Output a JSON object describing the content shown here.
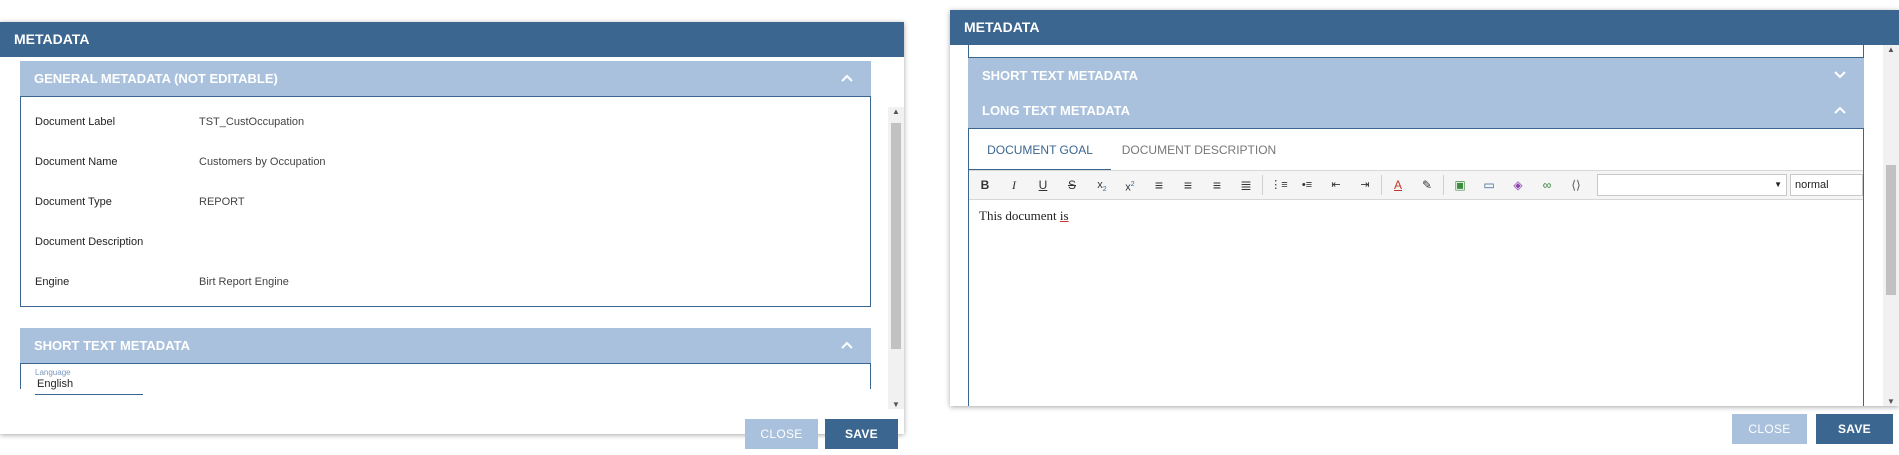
{
  "dialog1": {
    "title": "METADATA",
    "general_section": {
      "title": "GENERAL METADATA (NOT EDITABLE)",
      "rows": [
        {
          "label": "Document Label",
          "value": "TST_CustOccupation"
        },
        {
          "label": "Document Name",
          "value": "Customers by Occupation"
        },
        {
          "label": "Document Type",
          "value": "REPORT"
        },
        {
          "label": "Document Description",
          "value": ""
        },
        {
          "label": "Engine",
          "value": "Birt Report Engine"
        }
      ]
    },
    "short_section": {
      "title": "SHORT TEXT METADATA",
      "language_label": "Language",
      "language_value": "English"
    },
    "buttons": {
      "close": "CLOSE",
      "save": "SAVE"
    }
  },
  "dialog2": {
    "title": "METADATA",
    "short_section": {
      "title": "SHORT TEXT METADATA"
    },
    "long_section": {
      "title": "LONG TEXT METADATA"
    },
    "tabs": [
      "DOCUMENT GOAL",
      "DOCUMENT DESCRIPTION"
    ],
    "editor": {
      "font_select": "",
      "size_select": "normal",
      "text_plain": "This document ",
      "text_underlined": "is"
    },
    "buttons": {
      "close": "CLOSE",
      "save": "SAVE"
    }
  },
  "icons": {
    "chevron_up": "chevron-up-icon",
    "chevron_down": "chevron-down-icon"
  },
  "colors": {
    "primary": "#3b6690",
    "section_header": "#a9c1dc",
    "close_button": "#a9c1dc"
  }
}
